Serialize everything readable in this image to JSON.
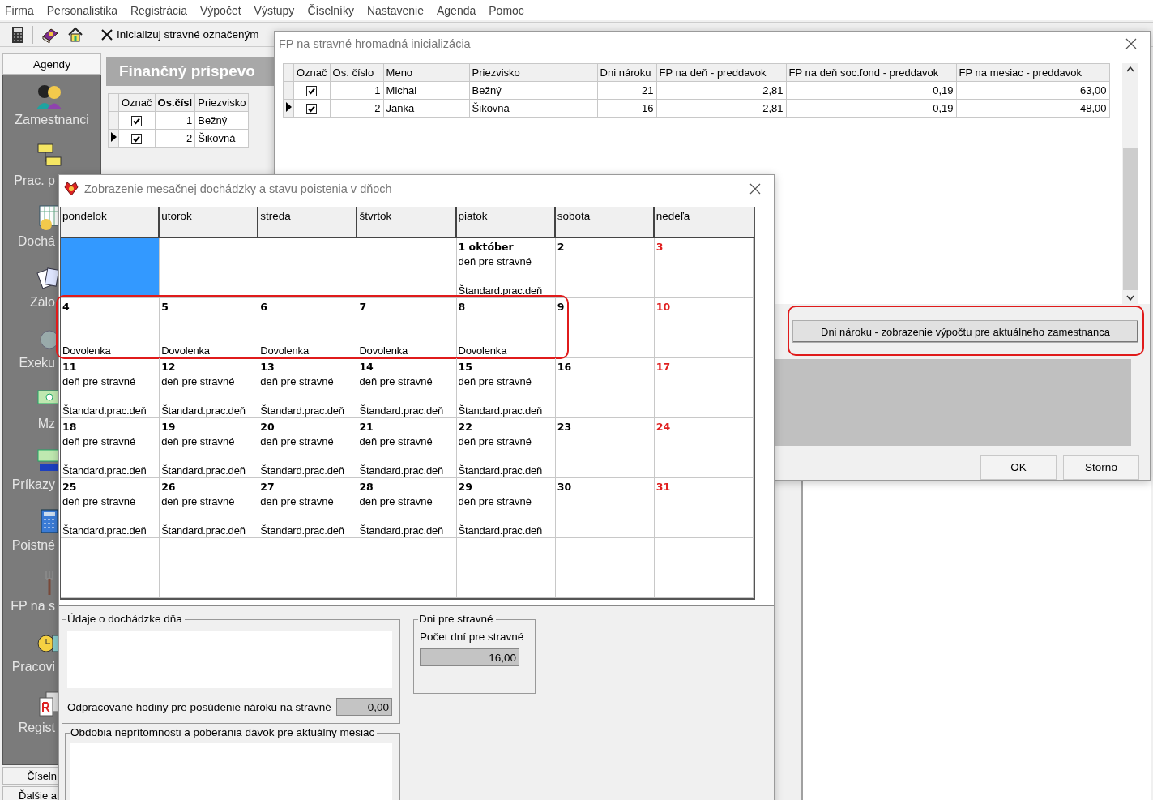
{
  "menu": [
    "Firma",
    "Personalistika",
    "Registrácia",
    "Výpočet",
    "Výstupy",
    "Číselníky",
    "Nastavenie",
    "Agenda",
    "Pomoc"
  ],
  "toolbar": {
    "action": "Inicializuj stravné označeným"
  },
  "sidebar": {
    "tab": {
      "label": "Agendy",
      "selected": true
    },
    "items": [
      {
        "label": "Zamestnanci"
      },
      {
        "label": "Prac. p"
      },
      {
        "label": "Dochá"
      },
      {
        "label": "Zálo"
      },
      {
        "label": "Exeku"
      },
      {
        "label": "Mz"
      },
      {
        "label": "Príkazy"
      },
      {
        "label": "Poistné"
      },
      {
        "label": "FP na s"
      },
      {
        "label": "Pracovi"
      },
      {
        "label": "Regist"
      }
    ],
    "bottom_tabs": [
      {
        "label": "Číseln",
        "selected": false
      },
      {
        "label": "Ďalšie a",
        "selected": false
      }
    ]
  },
  "main": {
    "title": "Finančný príspevo",
    "columns": [
      {
        "label": "Označ",
        "sorted": false
      },
      {
        "label": "Os.čísl",
        "sorted": true
      },
      {
        "label": "Priezvisko",
        "sorted": false
      }
    ],
    "rows": [
      {
        "selected": false,
        "checked": true,
        "number": "1",
        "surname": "Bežný"
      },
      {
        "selected": true,
        "checked": true,
        "number": "2",
        "surname": "Šikovná"
      }
    ]
  },
  "fp_dialog": {
    "title": "FP na stravné hromadná inicializácia",
    "columns": [
      "Označ",
      "Os. číslo",
      "Meno",
      "Priezvisko",
      "Dni nároku",
      "FP na deň - preddavok",
      "FP na deň soc.fond - preddavok",
      "FP na mesiac - preddavok"
    ],
    "rows": [
      {
        "selected": false,
        "checked": true,
        "number": "1",
        "name": "Michal",
        "surname": "Bežný",
        "days": "21",
        "per_day": "2,81",
        "social_fund": "0,19",
        "per_month": "63,00"
      },
      {
        "selected": true,
        "checked": true,
        "number": "2",
        "name": "Janka",
        "surname": "Šikovná",
        "days": "16",
        "per_day": "2,81",
        "social_fund": "0,19",
        "per_month": "48,00"
      }
    ],
    "detail_button": {
      "label": "Dni nároku - zobrazenie výpočtu pre aktuálneho zamestnanca",
      "highlighted": true
    },
    "buttons": [
      "OK",
      "Storno"
    ]
  },
  "calendar_dialog": {
    "title": "Zobrazenie mesačnej dochádzky a stavu poistenia v dňoch",
    "weekdays": [
      "pondelok",
      "utorok",
      "streda",
      "štvrtok",
      "piatok",
      "sobota",
      "nedeľa"
    ],
    "weeks": [
      {
        "highlighted": false,
        "days": [
          {
            "kind": "blank",
            "selected": true
          },
          {
            "kind": "blank",
            "selected": false
          },
          {
            "kind": "blank",
            "selected": false
          },
          {
            "kind": "blank",
            "selected": false
          },
          {
            "kind": "workday",
            "selected": false,
            "day": "1 október",
            "note": "deň pre stravné",
            "status": "Štandard.prac.deň"
          },
          {
            "kind": "saturday",
            "selected": false,
            "day": "2"
          },
          {
            "kind": "sunday",
            "selected": false,
            "day": "3"
          }
        ]
      },
      {
        "highlighted": true,
        "days": [
          {
            "kind": "workday",
            "selected": false,
            "day": "4",
            "status": "Dovolenka"
          },
          {
            "kind": "workday",
            "selected": false,
            "day": "5",
            "status": "Dovolenka"
          },
          {
            "kind": "workday",
            "selected": false,
            "day": "6",
            "status": "Dovolenka"
          },
          {
            "kind": "workday",
            "selected": false,
            "day": "7",
            "status": "Dovolenka"
          },
          {
            "kind": "workday",
            "selected": false,
            "day": "8",
            "status": "Dovolenka"
          },
          {
            "kind": "saturday",
            "selected": false,
            "day": "9"
          },
          {
            "kind": "sunday",
            "selected": false,
            "day": "10"
          }
        ]
      },
      {
        "highlighted": false,
        "days": [
          {
            "kind": "workday",
            "selected": false,
            "day": "11",
            "note": "deň pre stravné",
            "status": "Štandard.prac.deň"
          },
          {
            "kind": "workday",
            "selected": false,
            "day": "12",
            "note": "deň pre stravné",
            "status": "Štandard.prac.deň"
          },
          {
            "kind": "workday",
            "selected": false,
            "day": "13",
            "note": "deň pre stravné",
            "status": "Štandard.prac.deň"
          },
          {
            "kind": "workday",
            "selected": false,
            "day": "14",
            "note": "deň pre stravné",
            "status": "Štandard.prac.deň"
          },
          {
            "kind": "workday",
            "selected": false,
            "day": "15",
            "note": "deň pre stravné",
            "status": "Štandard.prac.deň"
          },
          {
            "kind": "saturday",
            "selected": false,
            "day": "16"
          },
          {
            "kind": "sunday",
            "selected": false,
            "day": "17"
          }
        ]
      },
      {
        "highlighted": false,
        "days": [
          {
            "kind": "workday",
            "selected": false,
            "day": "18",
            "note": "deň pre stravné",
            "status": "Štandard.prac.deň"
          },
          {
            "kind": "workday",
            "selected": false,
            "day": "19",
            "note": "deň pre stravné",
            "status": "Štandard.prac.deň"
          },
          {
            "kind": "workday",
            "selected": false,
            "day": "20",
            "note": "deň pre stravné",
            "status": "Štandard.prac.deň"
          },
          {
            "kind": "workday",
            "selected": false,
            "day": "21",
            "note": "deň pre stravné",
            "status": "Štandard.prac.deň"
          },
          {
            "kind": "workday",
            "selected": false,
            "day": "22",
            "note": "deň pre stravné",
            "status": "Štandard.prac.deň"
          },
          {
            "kind": "saturday",
            "selected": false,
            "day": "23"
          },
          {
            "kind": "sunday",
            "selected": false,
            "day": "24"
          }
        ]
      },
      {
        "highlighted": false,
        "days": [
          {
            "kind": "workday",
            "selected": false,
            "day": "25",
            "note": "deň pre stravné",
            "status": "Štandard.prac.deň"
          },
          {
            "kind": "workday",
            "selected": false,
            "day": "26",
            "note": "deň pre stravné",
            "status": "Štandard.prac.deň"
          },
          {
            "kind": "workday",
            "selected": false,
            "day": "27",
            "note": "deň pre stravné",
            "status": "Štandard.prac.deň"
          },
          {
            "kind": "workday",
            "selected": false,
            "day": "28",
            "note": "deň pre stravné",
            "status": "Štandard.prac.deň"
          },
          {
            "kind": "workday",
            "selected": false,
            "day": "29",
            "note": "deň pre stravné",
            "status": "Štandard.prac.deň"
          },
          {
            "kind": "saturday",
            "selected": false,
            "day": "30"
          },
          {
            "kind": "sunday",
            "selected": false,
            "day": "31"
          }
        ]
      },
      {
        "highlighted": false,
        "days": [
          {
            "kind": "blank",
            "selected": false
          },
          {
            "kind": "blank",
            "selected": false
          },
          {
            "kind": "blank",
            "selected": false
          },
          {
            "kind": "blank",
            "selected": false
          },
          {
            "kind": "blank",
            "selected": false
          },
          {
            "kind": "blank",
            "selected": false
          },
          {
            "kind": "blank",
            "selected": false
          }
        ]
      }
    ],
    "day_group": {
      "title": "Údaje o dochádzke dňa",
      "hours_label": "Odpracované hodiny pre posúdenie nároku na stravné",
      "hours_value": "0,00"
    },
    "absence_group": {
      "title": "Obdobia neprítomnosti a poberania dávok pre aktuálny mesiac"
    },
    "meal_group": {
      "title": "Dni pre stravné",
      "count_label": "Počet dní pre stravné",
      "count_value": "16,00"
    }
  }
}
